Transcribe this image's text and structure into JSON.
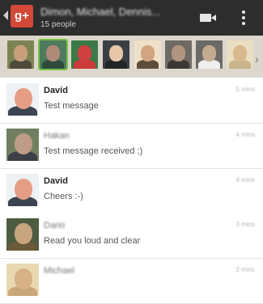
{
  "header": {
    "app_logo": "g+",
    "conversation_title": "Dimon, Michael, Dennis...",
    "participant_count": "15 people",
    "video_icon": "video-camera-icon",
    "menu_icon": "overflow-menu-icon"
  },
  "participants": {
    "tiles": [
      {
        "selected": false,
        "colors": {
          "bg": "#7c8454",
          "head": "#c9a07c",
          "body": "#4d4a3c"
        }
      },
      {
        "selected": true,
        "colors": {
          "bg": "#4e7a5d",
          "head": "#b08a78",
          "body": "#2e4a3c"
        }
      },
      {
        "selected": false,
        "colors": {
          "bg": "#3a7a46",
          "head": "#d04040",
          "body": "#cc3a3a"
        }
      },
      {
        "selected": false,
        "colors": {
          "bg": "#3b3f45",
          "head": "#e6c6a6",
          "body": "#222427"
        }
      },
      {
        "selected": false,
        "colors": {
          "bg": "#efe1c7",
          "head": "#d2a582",
          "body": "#5e4b3a"
        }
      },
      {
        "selected": false,
        "colors": {
          "bg": "#6f6a63",
          "head": "#b29581",
          "body": "#3c3833"
        }
      },
      {
        "selected": false,
        "colors": {
          "bg": "#6b6a66",
          "head": "#c4aa8e",
          "body": "#efefef"
        }
      },
      {
        "selected": false,
        "colors": {
          "bg": "#e9dfc3",
          "head": "#d8b88d",
          "body": "#c9b48c"
        }
      }
    ],
    "more_icon": "chevron-right-icon"
  },
  "messages": [
    {
      "sender": "David",
      "text": "Test message",
      "time": "5 mins",
      "sender_blurred": false,
      "avatar": {
        "bg": "#eef1f4",
        "face": "#e59e85",
        "body": "#3c4452"
      }
    },
    {
      "sender": "Hakan",
      "text": "Test message received ;)",
      "time": "4 mins",
      "sender_blurred": true,
      "avatar": {
        "bg": "#6f7f60",
        "face": "#bf9c86",
        "body": "#3c3f46"
      }
    },
    {
      "sender": "David",
      "text": "Cheers :-)",
      "time": "4 mins",
      "sender_blurred": false,
      "avatar": {
        "bg": "#eef1f4",
        "face": "#e59e85",
        "body": "#3c4452"
      }
    },
    {
      "sender": "Dario",
      "text": "Read you loud and clear",
      "time": "3 mins",
      "sender_blurred": true,
      "avatar": {
        "bg": "#4d5c3f",
        "face": "#c9a680",
        "body": "#6b5b3a"
      }
    },
    {
      "sender": "Michael",
      "text": "",
      "time": "2 mins",
      "sender_blurred": true,
      "avatar": {
        "bg": "#e8d9b2",
        "face": "#d9b288",
        "body": "#caa77a"
      }
    }
  ],
  "colors": {
    "topbar": "#2d2d2d",
    "participant_strip": "#ddd6cd",
    "gplus_red": "#d34836",
    "selected_outline": "#76c442"
  }
}
